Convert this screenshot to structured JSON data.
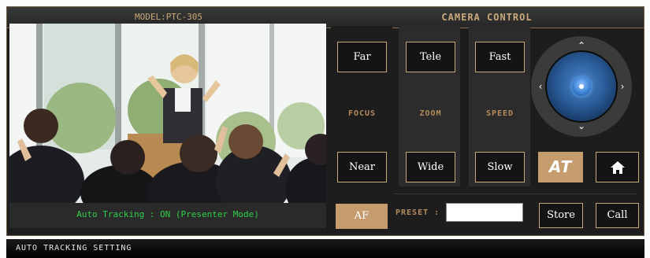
{
  "header": {
    "model_label": "MODEL:PTC-305",
    "control_title": "CAMERA CONTROL"
  },
  "video": {
    "status_text": "Auto Tracking : ON (Presenter Mode)"
  },
  "focus": {
    "far_label": "Far",
    "near_label": "Near",
    "label": "FOCUS",
    "af_label": "AF"
  },
  "zoom": {
    "tele_label": "Tele",
    "wide_label": "Wide",
    "label": "ZOOM"
  },
  "speed": {
    "fast_label": "Fast",
    "slow_label": "Slow",
    "label": "SPEED"
  },
  "joystick": {
    "up_icon": "chevron-up-icon",
    "down_icon": "chevron-down-icon",
    "left_icon": "chevron-left-icon",
    "right_icon": "chevron-right-icon"
  },
  "at_button": {
    "label": "AT"
  },
  "home_button": {
    "icon": "home-icon"
  },
  "preset": {
    "label": "PRESET :",
    "value": "",
    "store_label": "Store",
    "call_label": "Call"
  },
  "footer": {
    "title": "AUTO TRACKING SETTING"
  },
  "colors": {
    "accent_gold": "#c49c6e",
    "status_green": "#2fd04a",
    "panel_bg": "#1d1d1d"
  }
}
